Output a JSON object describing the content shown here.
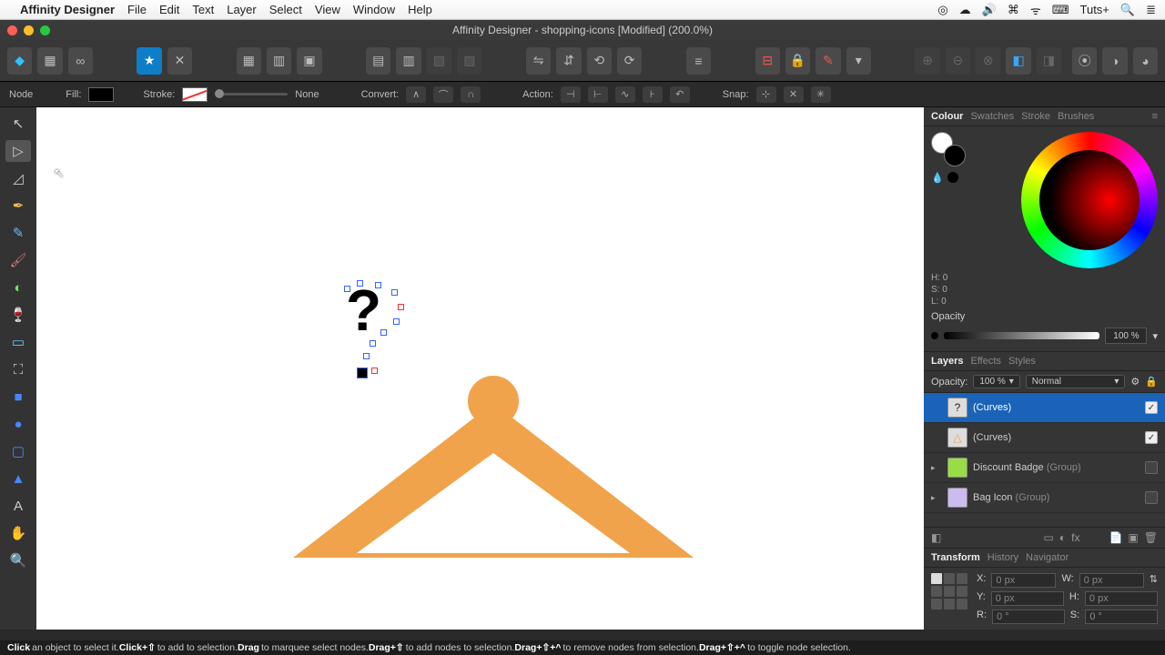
{
  "menubar": {
    "app": "Affinity Designer",
    "items": [
      "File",
      "Edit",
      "Text",
      "Layer",
      "Select",
      "View",
      "Window",
      "Help"
    ],
    "right": [
      "◎",
      "☁",
      "🔊",
      "⌘",
      "ᯤ",
      "⌨",
      "Tuts+",
      "🔍",
      "≣"
    ]
  },
  "window": {
    "title": "Affinity Designer - shopping-icons [Modified] (200.0%)"
  },
  "contextbar": {
    "tool_label": "Node",
    "fill_label": "Fill:",
    "stroke_label": "Stroke:",
    "stroke_width": "None",
    "convert_label": "Convert:",
    "action_label": "Action:",
    "snap_label": "Snap:"
  },
  "colour": {
    "tabs": [
      "Colour",
      "Swatches",
      "Stroke",
      "Brushes"
    ],
    "h": "H: 0",
    "s": "S: 0",
    "l": "L: 0",
    "opacity_label": "Opacity",
    "opacity_value": "100 %"
  },
  "layers": {
    "tabs": [
      "Layers",
      "Effects",
      "Styles"
    ],
    "opacity_label": "Opacity:",
    "opacity_value": "100 %",
    "blend_mode": "Normal",
    "items": [
      {
        "name": "(Curves)",
        "selected": true,
        "checked": true,
        "thumb": "?",
        "expandable": false
      },
      {
        "name": "(Curves)",
        "selected": false,
        "checked": true,
        "thumb": "△",
        "expandable": false
      },
      {
        "name": "Discount Badge",
        "suffix": "(Group)",
        "selected": false,
        "checked": false,
        "thumb": "●",
        "thumbColor": "#9d4",
        "expandable": true
      },
      {
        "name": "Bag Icon",
        "suffix": "(Group)",
        "selected": false,
        "checked": false,
        "thumb": "▇",
        "thumbColor": "#cbe",
        "expandable": true
      }
    ]
  },
  "transform": {
    "tabs": [
      "Transform",
      "History",
      "Navigator"
    ],
    "x_label": "X:",
    "x_val": "0 px",
    "y_label": "Y:",
    "y_val": "0 px",
    "w_label": "W:",
    "w_val": "0 px",
    "h_label": "H:",
    "h_val": "0 px",
    "r_label": "R:",
    "r_val": "0 °",
    "s_label": "S:",
    "s_val": "0 °"
  },
  "status": {
    "parts": [
      {
        "b": "Click",
        "t": " an object to select it. "
      },
      {
        "b": "Click+⇧",
        "t": " to add to selection. "
      },
      {
        "b": "Drag",
        "t": " to marquee select nodes. "
      },
      {
        "b": "Drag+⇧",
        "t": " to add nodes to selection. "
      },
      {
        "b": "Drag+⇧+^",
        "t": " to remove nodes from selection. "
      },
      {
        "b": "Drag+⇧+^",
        "t": " to toggle node selection."
      }
    ]
  }
}
